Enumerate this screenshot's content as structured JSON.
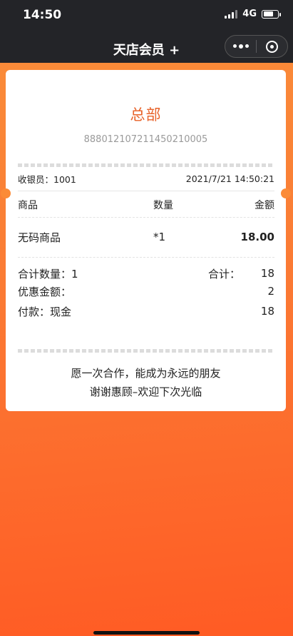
{
  "status_bar": {
    "time": "14:50",
    "network": "4G"
  },
  "nav": {
    "title": "天店会员 +"
  },
  "receipt": {
    "store_name": "总部",
    "order_number": "888012107211450210005",
    "cashier": "收银员：1001",
    "datetime": "2021/7/21 14:50:21",
    "columns": {
      "item": "商品",
      "qty": "数量",
      "amount": "金额"
    },
    "items": [
      {
        "name": "无码商品",
        "qty": "*1",
        "amount": "18.00"
      }
    ],
    "summary": {
      "total_qty_label": "合计数量：1",
      "total_label": "合计：",
      "total_value": "18",
      "discount_label": "优惠金额：",
      "discount_value": "2",
      "payment_label": "付款：现金",
      "payment_value": "18"
    },
    "footer": {
      "line1": "愿一次合作，能成为永远的朋友",
      "line2": "谢谢惠顾–欢迎下次光临"
    }
  }
}
